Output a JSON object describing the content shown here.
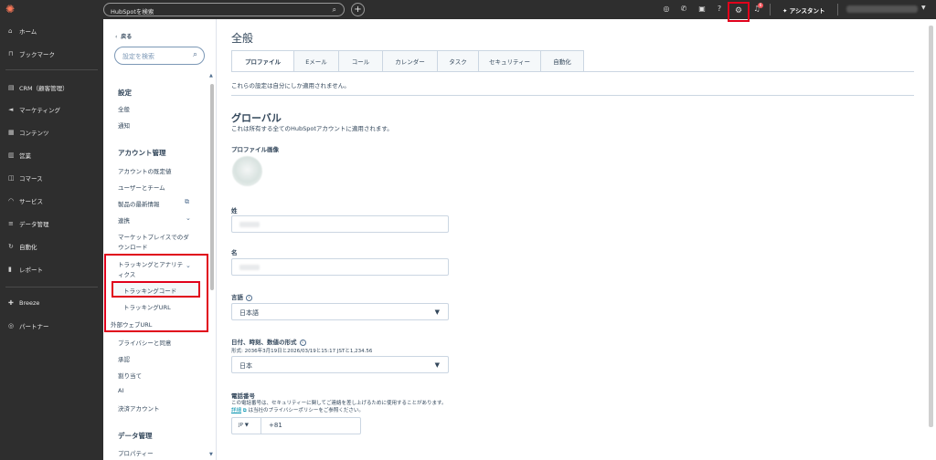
{
  "topbar": {
    "search_placeholder": "HubSpotを検索",
    "assistant_label": "アシスタント",
    "notification_count": "6"
  },
  "leftnav": {
    "items": [
      {
        "label": "ホーム",
        "icon": "home-icon"
      },
      {
        "label": "ブックマーク",
        "icon": "bookmark-icon"
      },
      {
        "label": "CRM（顧客管理）",
        "icon": "crm-icon"
      },
      {
        "label": "マーケティング",
        "icon": "marketing-icon"
      },
      {
        "label": "コンテンツ",
        "icon": "content-icon"
      },
      {
        "label": "営業",
        "icon": "sales-icon"
      },
      {
        "label": "コマース",
        "icon": "commerce-icon"
      },
      {
        "label": "サービス",
        "icon": "service-icon"
      },
      {
        "label": "データ管理",
        "icon": "data-icon"
      },
      {
        "label": "自動化",
        "icon": "automation-icon"
      },
      {
        "label": "レポート",
        "icon": "reports-icon"
      },
      {
        "label": "Breeze",
        "icon": "breeze-icon"
      },
      {
        "label": "パートナー",
        "icon": "partner-icon"
      }
    ]
  },
  "sidebar": {
    "back_label": "戻る",
    "search_placeholder": "設定を検索",
    "settings_heading": "設定",
    "settings_items": [
      "全般",
      "通知"
    ],
    "account_heading": "アカウント管理",
    "account_items": {
      "defaults": "アカウントの既定値",
      "users_teams": "ユーザーとチーム",
      "product_updates": "製品の最新情報",
      "integrations": "連携",
      "marketplace_line1": "マーケットプレイスでのダ",
      "marketplace_line2": "ウンロード",
      "tracking_line1": "トラッキングとアナリテ",
      "tracking_line2": "ィクス",
      "tracking_code": "トラッキングコード",
      "tracking_url": "トラッキングURL",
      "external_url": "外部ウェブURL",
      "privacy": "プライバシーと同意",
      "approvals": "承認",
      "assignments": "割り当て",
      "ai": "AI",
      "billing": "決済アカウント"
    },
    "data_heading": "データ管理",
    "data_items": [
      "プロパティー"
    ]
  },
  "main": {
    "title": "全般",
    "tabs": [
      "プロファイル",
      "Eメール",
      "コール",
      "カレンダー",
      "タスク",
      "セキュリティー",
      "自動化"
    ],
    "notice": "これらの設定は自分にしか適用されません。",
    "global_title": "グローバル",
    "global_desc": "これは所有する全てのHubSpotアカウントに適用されます。",
    "profile_image_label": "プロファイル画像",
    "last_name_label": "姓",
    "first_name_label": "名",
    "language_label": "言語",
    "language_value": "日本語",
    "datetime_label": "日付、時刻、数値の形式",
    "datetime_hint": "形式: 2036年3月19日と2026/03/19と15:17 JSTと1,234.56",
    "datetime_value": "日本",
    "phone_label": "電話番号",
    "phone_desc_1": "この電話番号は、セキュリティーに関してご連絡を差し上げるために使用することがあります。",
    "phone_detail_link": "詳細",
    "phone_desc_2": "は当社のプライバシーポリシーをご参照ください。",
    "phone_country": "JP",
    "phone_number": "+81"
  },
  "colors": {
    "topbar_bg": "#2e2e2e",
    "accent_orange": "#ff7a59",
    "highlight_red": "#e0001b",
    "text_primary": "#33475b",
    "link": "#0091ae"
  }
}
